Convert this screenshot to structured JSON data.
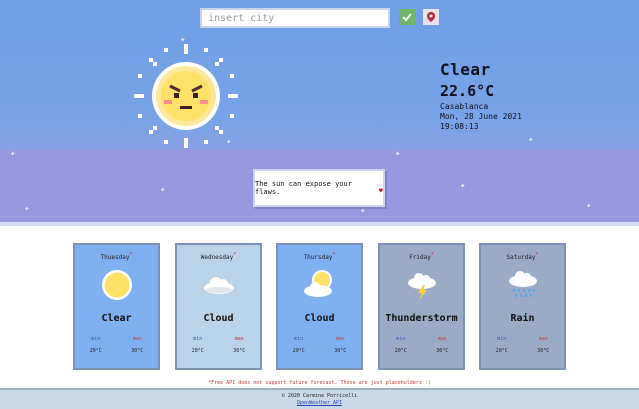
{
  "search": {
    "placeholder": "insert city"
  },
  "current": {
    "condition": "Clear",
    "temperature": "22.6°C",
    "city": "Casablanca",
    "date": "Mon, 28 June 2021",
    "time": "19:08:13"
  },
  "quote": {
    "text": "The sun can expose your flaws."
  },
  "forecast": [
    {
      "day": "Thuesday",
      "condition": "Clear",
      "min_label": "min",
      "max_label": "max",
      "min": "20°C",
      "max": "30°C",
      "icon": "sun-icon",
      "bg": "#7fb1f2"
    },
    {
      "day": "Wednesday",
      "condition": "Cloud",
      "min_label": "min",
      "max_label": "max",
      "min": "20°C",
      "max": "30°C",
      "icon": "cloud-icon",
      "bg": "#b9d3e9"
    },
    {
      "day": "Thursday",
      "condition": "Cloud",
      "min_label": "min",
      "max_label": "max",
      "min": "20°C",
      "max": "30°C",
      "icon": "sun-cloud-icon",
      "bg": "#7fb1f2"
    },
    {
      "day": "Friday",
      "condition": "Thunderstorm",
      "min_label": "min",
      "max_label": "max",
      "min": "20°C",
      "max": "30°C",
      "icon": "thunderstorm-icon",
      "bg": "#9aabc6"
    },
    {
      "day": "Saturday",
      "condition": "Rain",
      "min_label": "min",
      "max_label": "max",
      "min": "20°C",
      "max": "30°C",
      "icon": "rain-icon",
      "bg": "#9aabc6"
    }
  ],
  "note": "*Free API does not support future forecast. Those are just placeholders :(",
  "footer": {
    "copyright": "© 2020 Carmine Porricelli",
    "link": "OpenWeather API"
  },
  "colors": {
    "sky": "#6e9fe6",
    "band": "#9799e0",
    "accent_red": "#d0243c",
    "confirm_green": "#6fb36a"
  }
}
